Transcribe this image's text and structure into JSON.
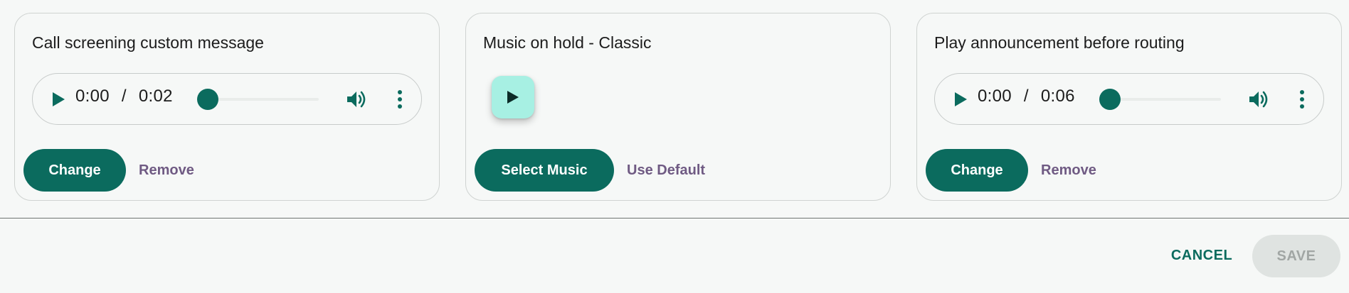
{
  "cards": [
    {
      "title": "Call screening custom message",
      "player": {
        "current_time": "0:00",
        "separator": "/",
        "duration": "0:02",
        "progress": 0
      },
      "primary_label": "Change",
      "secondary_label": "Remove"
    },
    {
      "title": "Music on hold - Classic",
      "primary_label": "Select Music",
      "secondary_label": "Use Default"
    },
    {
      "title": "Play announcement before routing",
      "player": {
        "current_time": "0:00",
        "separator": "/",
        "duration": "0:06",
        "progress": 0
      },
      "primary_label": "Change",
      "secondary_label": "Remove"
    }
  ],
  "footer": {
    "cancel_label": "CANCEL",
    "save_label": "SAVE",
    "save_enabled": false
  },
  "icons": {
    "play": "play-icon",
    "volume": "volume-icon",
    "more": "more-vertical-icon"
  },
  "colors": {
    "accent": "#0b6b5e",
    "accent_light": "#a7f0e3",
    "text_button": "#6f5a83",
    "disabled_bg": "#dfe3e1",
    "disabled_text": "#a1a6a4",
    "background": "#f6f8f7"
  }
}
